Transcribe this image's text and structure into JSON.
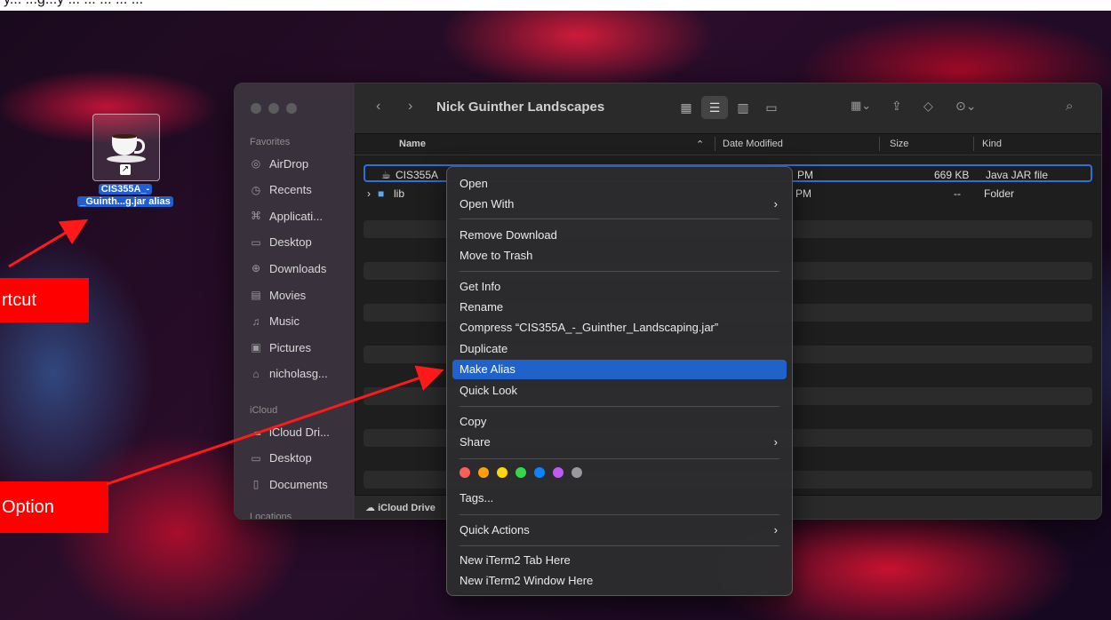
{
  "caption": "y... ...g...y ... ... ... ... ...",
  "desktop_icon": {
    "line1": "CIS355A_-",
    "line2": "_Guinth...g.jar alias"
  },
  "annotations": {
    "shortcut": "rtcut",
    "option": "Option"
  },
  "finder": {
    "title": "Nick Guinther Landscapes",
    "sidebar": {
      "favorites_header": "Favorites",
      "favorites": [
        {
          "label": "AirDrop",
          "icon": "airdrop-icon"
        },
        {
          "label": "Recents",
          "icon": "clock-icon"
        },
        {
          "label": "Applicati...",
          "icon": "applications-icon"
        },
        {
          "label": "Desktop",
          "icon": "desktop-icon"
        },
        {
          "label": "Downloads",
          "icon": "download-icon"
        },
        {
          "label": "Movies",
          "icon": "film-icon"
        },
        {
          "label": "Music",
          "icon": "music-icon"
        },
        {
          "label": "Pictures",
          "icon": "photo-icon"
        },
        {
          "label": "nicholasg...",
          "icon": "home-icon"
        }
      ],
      "icloud_header": "iCloud",
      "icloud": [
        {
          "label": "iCloud Dri...",
          "icon": "cloud-icon"
        },
        {
          "label": "Desktop",
          "icon": "desktop-icon"
        },
        {
          "label": "Documents",
          "icon": "document-icon"
        }
      ],
      "locations_header": "Locations"
    },
    "columns": {
      "name": "Name",
      "date": "Date Modified",
      "size": "Size",
      "kind": "Kind"
    },
    "rows": [
      {
        "name": "CIS355A",
        "date": "PM",
        "size": "669 KB",
        "kind": "Java JAR file"
      },
      {
        "name": "lib",
        "date": "PM",
        "size": "--",
        "kind": "Folder"
      }
    ],
    "pathbar": "iCloud Drive"
  },
  "context_menu": {
    "open": "Open",
    "open_with": "Open With",
    "remove_download": "Remove Download",
    "move_to_trash": "Move to Trash",
    "get_info": "Get Info",
    "rename": "Rename",
    "compress": "Compress “CIS355A_-_Guinther_Landscaping.jar”",
    "duplicate": "Duplicate",
    "make_alias": "Make Alias",
    "quick_look": "Quick Look",
    "copy": "Copy",
    "share": "Share",
    "tags": "Tags...",
    "quick_actions": "Quick Actions",
    "new_iterm_tab": "New iTerm2 Tab Here",
    "new_iterm_window": "New iTerm2 Window Here",
    "tag_colors": [
      "#ff5f57",
      "#ff9f0a",
      "#ffd60a",
      "#32d74b",
      "#0a84ff",
      "#bf5af2",
      "#98989d"
    ]
  }
}
